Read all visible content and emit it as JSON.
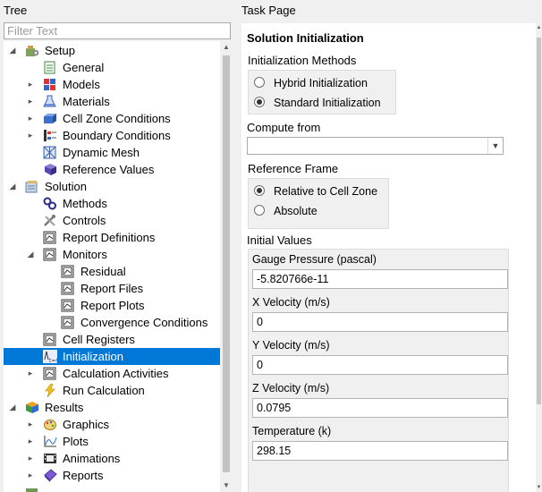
{
  "tree_panel": {
    "header": "Tree",
    "filter_placeholder": "Filter Text",
    "items": [
      {
        "label": "Setup",
        "icon": "setup-icon",
        "expanded": true
      },
      {
        "label": "General",
        "icon": "general-icon"
      },
      {
        "label": "Models",
        "icon": "models-icon"
      },
      {
        "label": "Materials",
        "icon": "materials-icon"
      },
      {
        "label": "Cell Zone Conditions",
        "icon": "cell-zone-icon"
      },
      {
        "label": "Boundary Conditions",
        "icon": "boundary-conditions-icon"
      },
      {
        "label": "Dynamic Mesh",
        "icon": "dynamic-mesh-icon"
      },
      {
        "label": "Reference Values",
        "icon": "reference-values-icon"
      },
      {
        "label": "Solution",
        "icon": "solution-icon",
        "expanded": true
      },
      {
        "label": "Methods",
        "icon": "methods-icon"
      },
      {
        "label": "Controls",
        "icon": "controls-icon"
      },
      {
        "label": "Report Definitions",
        "icon": "report-definitions-icon"
      },
      {
        "label": "Monitors",
        "icon": "monitors-icon",
        "expanded": true
      },
      {
        "label": "Residual",
        "icon": "residual-icon"
      },
      {
        "label": "Report Files",
        "icon": "report-files-icon"
      },
      {
        "label": "Report Plots",
        "icon": "report-plots-icon"
      },
      {
        "label": "Convergence Conditions",
        "icon": "convergence-conditions-icon"
      },
      {
        "label": "Cell Registers",
        "icon": "cell-registers-icon"
      },
      {
        "label": "Initialization",
        "icon": "initialization-icon",
        "selected": true
      },
      {
        "label": "Calculation Activities",
        "icon": "calculation-activities-icon"
      },
      {
        "label": "Run Calculation",
        "icon": "run-calculation-icon"
      },
      {
        "label": "Results",
        "icon": "results-icon",
        "expanded": true
      },
      {
        "label": "Graphics",
        "icon": "graphics-icon"
      },
      {
        "label": "Plots",
        "icon": "plots-icon"
      },
      {
        "label": "Animations",
        "icon": "animations-icon"
      },
      {
        "label": "Reports",
        "icon": "reports-icon"
      }
    ]
  },
  "task_panel": {
    "header": "Task Page",
    "title": "Solution Initialization",
    "methods": {
      "label": "Initialization Methods",
      "options": [
        {
          "label": "Hybrid  Initialization",
          "checked": false
        },
        {
          "label": "Standard Initialization",
          "checked": true
        }
      ]
    },
    "compute_from": {
      "label": "Compute from",
      "value": ""
    },
    "reference_frame": {
      "label": "Reference Frame",
      "options": [
        {
          "label": "Relative to Cell Zone",
          "checked": true
        },
        {
          "label": "Absolute",
          "checked": false
        }
      ]
    },
    "initial_values": {
      "label": "Initial Values",
      "fields": [
        {
          "label": "Gauge Pressure (pascal)",
          "value": "-5.820766e-11"
        },
        {
          "label": "X Velocity (m/s)",
          "value": "0"
        },
        {
          "label": "Y Velocity (m/s)",
          "value": "0"
        },
        {
          "label": "Z Velocity (m/s)",
          "value": "0.0795"
        },
        {
          "label": "Temperature (k)",
          "value": "298.15"
        }
      ]
    }
  },
  "colors": {
    "selection": "#0078d7",
    "panel_bg": "#f0f0f0"
  }
}
